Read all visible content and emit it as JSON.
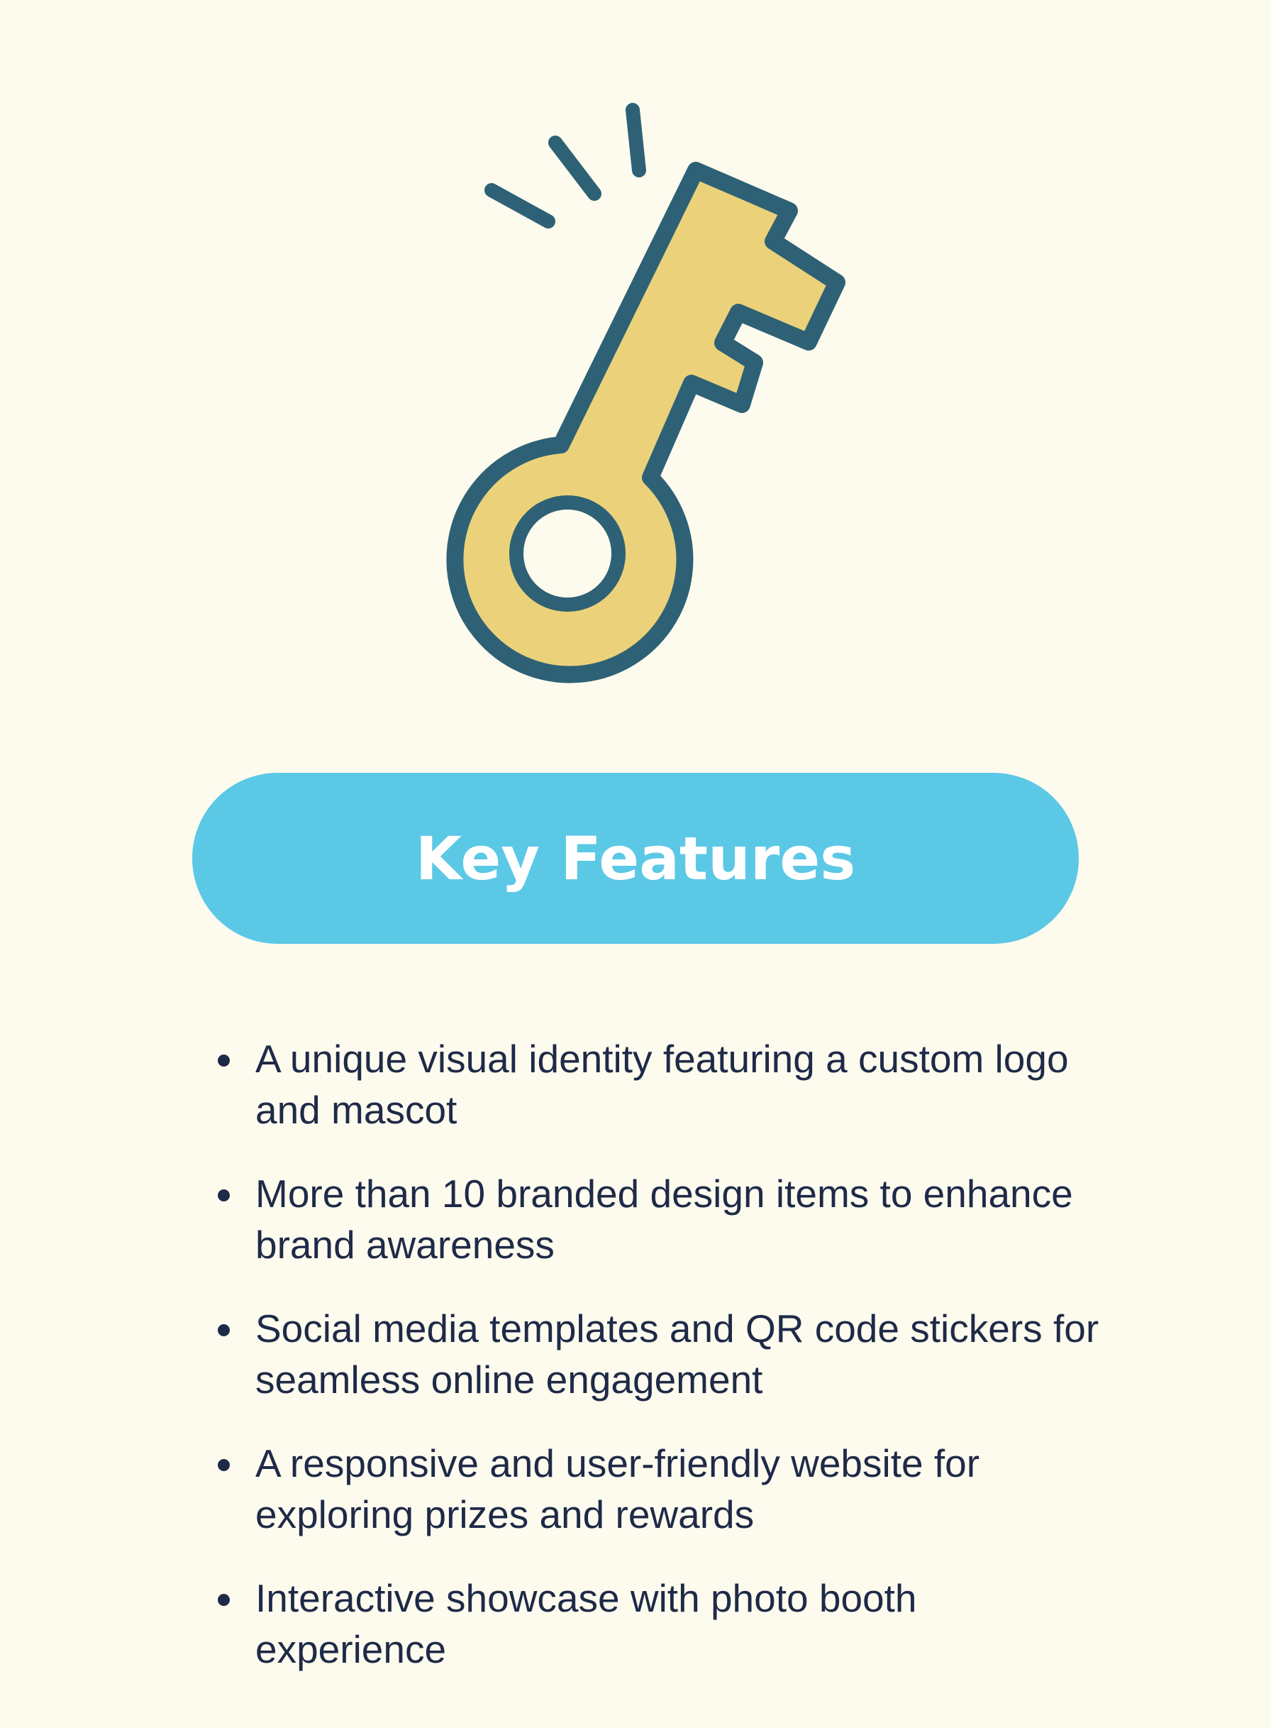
{
  "illustration": {
    "icon": "key-icon",
    "key_fill": "#ebd27a",
    "outline": "#2e6175"
  },
  "header": {
    "title": "Key Features",
    "pill_color": "#5bc8e6",
    "title_color": "#ffffff"
  },
  "features": [
    {
      "text": "A unique visual identity featuring a custom logo and mascot"
    },
    {
      "text": "More than 10 branded design items to enhance brand awareness"
    },
    {
      "text": "Social media templates and QR code stickers for seamless online engagement"
    },
    {
      "text": "A responsive and user-friendly website for exploring prizes and rewards"
    },
    {
      "text": "Interactive showcase with photo booth experience"
    }
  ],
  "colors": {
    "background": "#fdfbee",
    "text": "#1f2a48"
  }
}
